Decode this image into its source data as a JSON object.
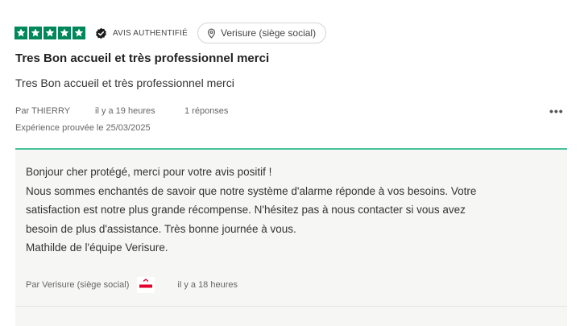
{
  "review": {
    "rating": 5,
    "rating_max": 5,
    "star_color": "#00875a",
    "verified_label": "AVIS AUTHENTIFIÉ",
    "location": "Verisure (siège social)",
    "title": "Tres Bon accueil et très professionnel merci",
    "body": "Tres Bon accueil et très professionnel merci",
    "author": "Par THIERRY",
    "time_ago": "il y a 19 heures",
    "replies_count": "1 réponses",
    "more_label": "•••",
    "experience": "Expérience prouvée le 25/03/2025"
  },
  "reply": {
    "accent_color": "#45c29a",
    "lines": [
      "Bonjour cher protégé, merci pour votre avis positif !",
      "Nous sommes enchantés de savoir que notre système d'alarme réponde à vos besoins. Votre",
      "satisfaction est notre plus grande récompense. N'hésitez pas à nous contacter si vous avez",
      "besoin de plus d'assistance. Très bonne journée à vous.",
      "Mathilde de l'équipe Verisure."
    ],
    "author": "Par Verisure (siège social)",
    "logo_text": "verisure",
    "time_ago": "il y a 18 heures"
  }
}
